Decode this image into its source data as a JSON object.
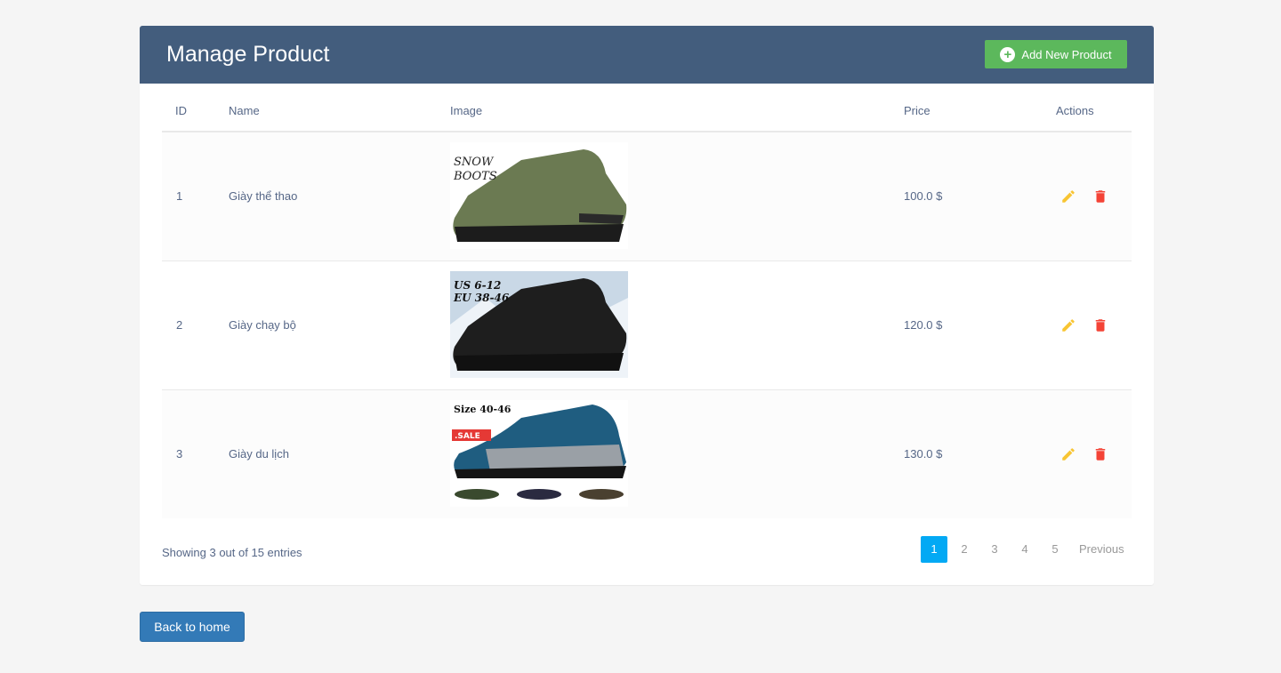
{
  "header": {
    "title": "Manage Product",
    "add_label": "Add New Product"
  },
  "table": {
    "columns": {
      "id": "ID",
      "name": "Name",
      "image": "Image",
      "price": "Price",
      "actions": "Actions"
    },
    "rows": [
      {
        "id": "1",
        "name": "Giày thể thao",
        "price": "100.0 $",
        "image_text": [
          "SNOW",
          "BOOTS"
        ],
        "image_color": "#6b7a52"
      },
      {
        "id": "2",
        "name": "Giày chạy bộ",
        "price": "120.0 $",
        "image_text": [
          "US 6-12",
          "EU 38-46"
        ],
        "image_color": "#1e1e1e"
      },
      {
        "id": "3",
        "name": "Giày du lịch",
        "price": "130.0 $",
        "image_text": [
          "Size 40-46",
          ".SALE"
        ],
        "image_color": "#1f5d80"
      }
    ]
  },
  "footer": {
    "hint": "Showing 3 out of 15 entries",
    "pages": [
      "1",
      "2",
      "3",
      "4",
      "5"
    ],
    "active_page": "1",
    "previous_label": "Previous"
  },
  "home_button": "Back to home",
  "colors": {
    "header_bg": "#435d7d",
    "add_btn": "#5cb85c",
    "edit": "#f8c533",
    "delete": "#f44336",
    "active_page": "#03a9f4",
    "home_btn": "#337ab7"
  }
}
